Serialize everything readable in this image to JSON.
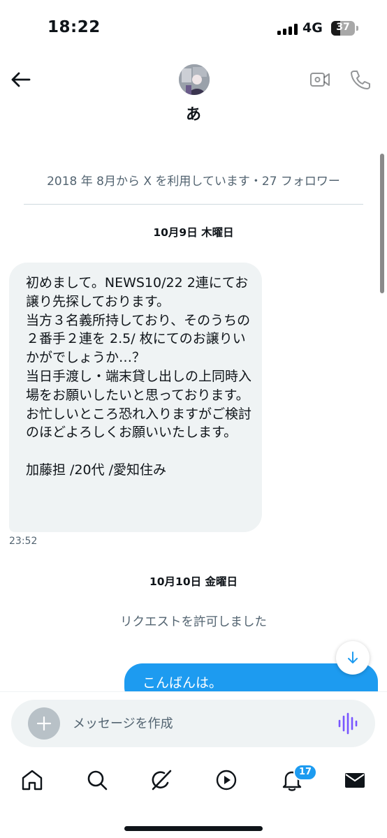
{
  "status_bar": {
    "time": "18:22",
    "network": "4G",
    "battery": "37",
    "battery_level": 0.37
  },
  "header": {
    "name": "あ"
  },
  "conversation": {
    "user_info": "2018 年 8月から X を利用しています・27 フォロワー",
    "date_1": "10月9日 木曜日",
    "message_1": "初めまして。NEWS10/22 2連にてお譲り先探しております。\n当方３名義所持しており、そのうちの２番手２連を 2.5/ 枚にてのお譲りいかがでしょうか…？\n当日手渡し・端末貸し出しの上同時入場をお願いしたいと思っております。\nお忙しいところ恐れ入りますがご検討のほどよろしくお願いいたします。\n\n加藤担 /20代 /愛知住み",
    "message_1_time": "23:52",
    "date_2": "10月10日 金曜日",
    "system_message": "リクエストを許可しました",
    "message_2": "こんばんは。"
  },
  "composer": {
    "placeholder": "メッセージを作成"
  },
  "nav": {
    "notifications_badge": "17"
  },
  "colors": {
    "accent": "#1d9bf0",
    "bubble_in": "#eff3f4",
    "secondary_text": "#536471",
    "voice": "#7856ff"
  },
  "icons": {
    "back": "arrow-left-icon",
    "video": "video-camera-icon",
    "call": "phone-icon",
    "scroll_down": "arrow-down-icon",
    "add": "plus-icon",
    "voice": "voice-wave-icon",
    "home": "home-icon",
    "search": "search-icon",
    "grok": "grok-icon",
    "media": "play-icon",
    "notifications": "bell-icon",
    "messages": "mail-icon"
  }
}
